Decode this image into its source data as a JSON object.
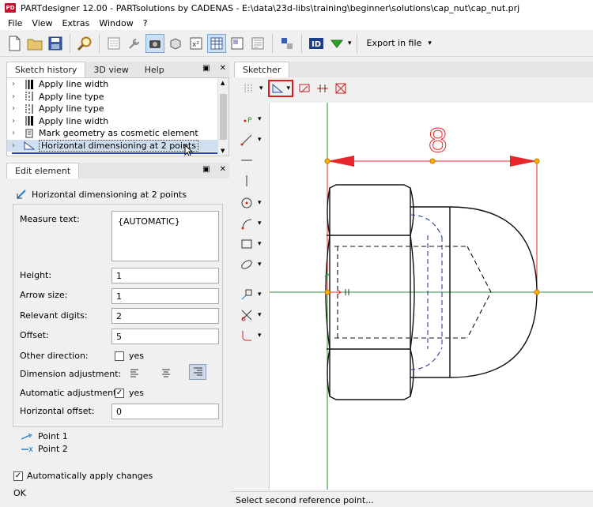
{
  "window": {
    "title": "PARTdesigner 12.00 - PARTsolutions by CADENAS - E:\\data\\23d-libs\\training\\beginner\\solutions\\cap_nut\\cap_nut.prj",
    "app_icon": "PD"
  },
  "menu": [
    "File",
    "View",
    "Extras",
    "Window",
    "?"
  ],
  "toolbar": {
    "export_label": "Export in file"
  },
  "history_panel": {
    "tabs": [
      "Sketch history",
      "3D view",
      "Help"
    ],
    "items": [
      {
        "label": "Apply line width",
        "icon": "line-width-icon"
      },
      {
        "label": "Apply line type",
        "icon": "line-type-icon"
      },
      {
        "label": "Apply line type",
        "icon": "line-type-icon"
      },
      {
        "label": "Apply line width",
        "icon": "line-width-icon"
      },
      {
        "label": "Mark geometry as cosmetic element",
        "icon": "cosmetic-icon"
      },
      {
        "label": "Horizontal dimensioning at 2 points",
        "icon": "horizontal-dimension-icon"
      }
    ]
  },
  "edit_panel": {
    "tab": "Edit element",
    "title": "Horizontal dimensioning at 2 points",
    "fields": {
      "measure_text_label": "Measure text:",
      "measure_text_value": "{AUTOMATIC}",
      "height_label": "Height:",
      "height_value": "1",
      "arrow_size_label": "Arrow size:",
      "arrow_size_value": "1",
      "relevant_digits_label": "Relevant digits:",
      "relevant_digits_value": "2",
      "offset_label": "Offset:",
      "offset_value": "5",
      "other_direction_label": "Other direction:",
      "other_direction_yes": "yes",
      "dimension_adjustment_label": "Dimension adjustment:",
      "automatic_adjustment_label": "Automatic adjustment:",
      "automatic_adjustment_yes": "yes",
      "horizontal_offset_label": "Horizontal offset:",
      "horizontal_offset_value": "0"
    },
    "points": [
      "Point 1",
      "Point 2"
    ],
    "auto_apply_label": "Automatically apply changes",
    "ok_label": "OK"
  },
  "sketcher": {
    "tab": "Sketcher",
    "dimension_text": "8"
  },
  "status": {
    "text": "Select second reference point..."
  },
  "colors": {
    "accent_red": "#e01b1b",
    "selection": "#cfdff0",
    "dim_red": "#e8262c",
    "axis_green": "#2e8b3a",
    "hidden_blue": "#2a3f8f"
  }
}
